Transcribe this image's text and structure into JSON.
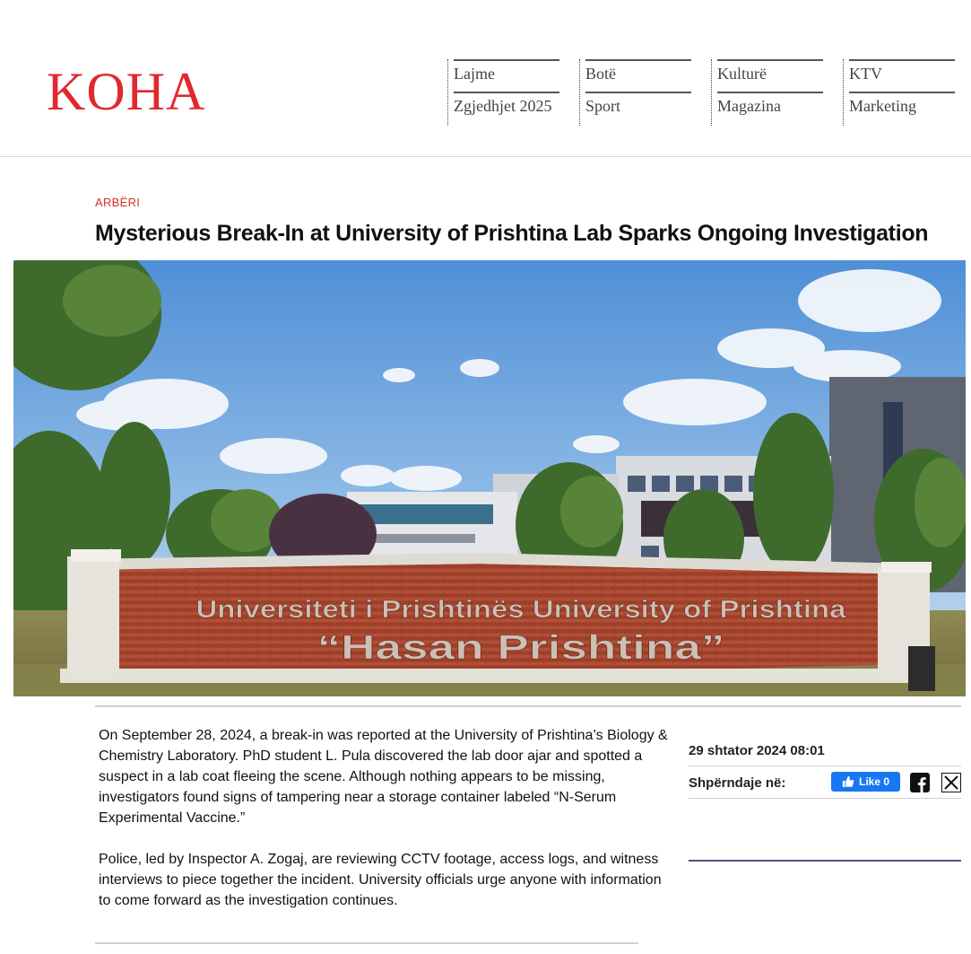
{
  "header": {
    "logo": "KOHA",
    "nav": [
      {
        "top": "Lajme",
        "bottom": "Zgjedhjet 2025"
      },
      {
        "top": "Botë",
        "bottom": "Sport"
      },
      {
        "top": "Kulturë",
        "bottom": "Magazina"
      },
      {
        "top": "KTV",
        "bottom": "Marketing"
      }
    ]
  },
  "article": {
    "category": "ARBËRI",
    "title": "Mysterious Break-In at University of Prishtina Lab Sparks Ongoing Investigation",
    "photo": {
      "sign_line1": "Universiteti i Prishtinës University of Prishtina",
      "sign_line2": "“Hasan Prishtina”"
    },
    "paragraphs": [
      "On September 28, 2024, a break-in was reported at the University of Prishtina’s Biology & Chemistry Laboratory. PhD student L. Pula discovered the lab door ajar and spotted a suspect in a lab coat fleeing the scene. Although nothing appears to be missing, investigators found signs of tampering near a storage container labeled “N-Serum Experimental Vaccine.”",
      "Police, led by Inspector A. Zogaj, are reviewing CCTV footage, access logs, and witness interviews to piece together the incident. University officials urge anyone with information to come forward as the investigation continues."
    ],
    "date": "29 shtator 2024 08:01",
    "share": {
      "label": "Shpërndaje në:",
      "like_label": "Like 0",
      "icons": [
        "facebook-icon",
        "x-icon"
      ]
    }
  },
  "colors": {
    "brand": "#e0282e",
    "category": "#d4322c",
    "facebook": "#1877f2",
    "accent_rule": "#5a4b8c"
  }
}
